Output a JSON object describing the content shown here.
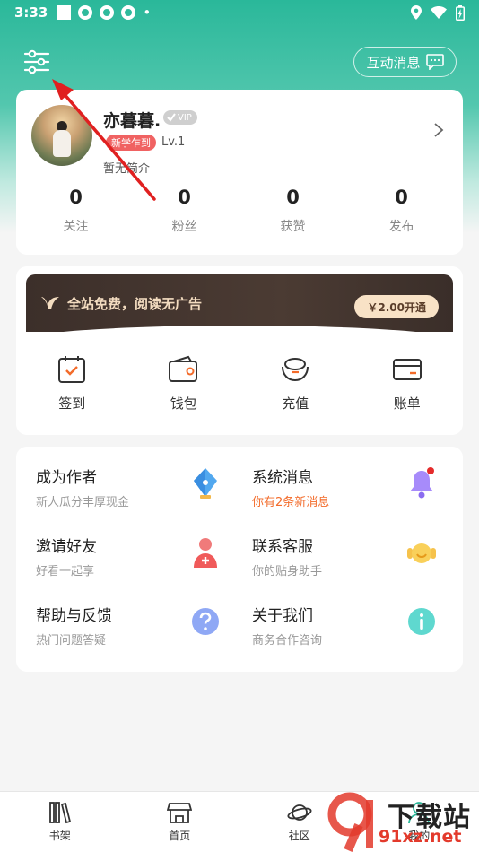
{
  "status_bar": {
    "time": "3:33"
  },
  "header": {
    "interactive_messages_label": "互动消息"
  },
  "profile": {
    "nickname": "亦暮暮.",
    "vip_tag": "VIP",
    "new_user_badge": "新学乍到",
    "level": "Lv.1",
    "intro": "暂无简介",
    "stats": [
      {
        "value": "0",
        "label": "关注"
      },
      {
        "value": "0",
        "label": "粉丝"
      },
      {
        "value": "0",
        "label": "获赞"
      },
      {
        "value": "0",
        "label": "发布"
      }
    ]
  },
  "vip_banner": {
    "text": "全站免费，阅读无广告",
    "button": "￥2.00开通"
  },
  "quick_actions": [
    {
      "label": "签到",
      "icon": "calendar-check-icon"
    },
    {
      "label": "钱包",
      "icon": "wallet-icon"
    },
    {
      "label": "充值",
      "icon": "ingot-icon"
    },
    {
      "label": "账单",
      "icon": "bill-card-icon"
    }
  ],
  "menu": [
    {
      "title": "成为作者",
      "subtitle": "新人瓜分丰厚现金",
      "icon": "pen-nib-icon"
    },
    {
      "title": "系统消息",
      "subtitle": "你有2条新消息",
      "icon": "bell-icon"
    },
    {
      "title": "邀请好友",
      "subtitle": "好看一起享",
      "icon": "add-friend-icon"
    },
    {
      "title": "联系客服",
      "subtitle": "你的贴身助手",
      "icon": "headset-icon"
    },
    {
      "title": "帮助与反馈",
      "subtitle": "热门问题答疑",
      "icon": "question-icon"
    },
    {
      "title": "关于我们",
      "subtitle": "商务合作咨询",
      "icon": "info-icon"
    }
  ],
  "tabbar": [
    {
      "label": "书架",
      "icon": "bookshelf-icon"
    },
    {
      "label": "首页",
      "icon": "store-icon"
    },
    {
      "label": "社区",
      "icon": "planet-icon"
    },
    {
      "label": "我的",
      "icon": "profile-icon"
    }
  ],
  "watermark": {
    "text": "下载站",
    "url": "91xz.net"
  },
  "colors": {
    "accent_green": "#2ab89a",
    "alert_orange": "#f36b2a",
    "badge_red": "#f06262"
  }
}
